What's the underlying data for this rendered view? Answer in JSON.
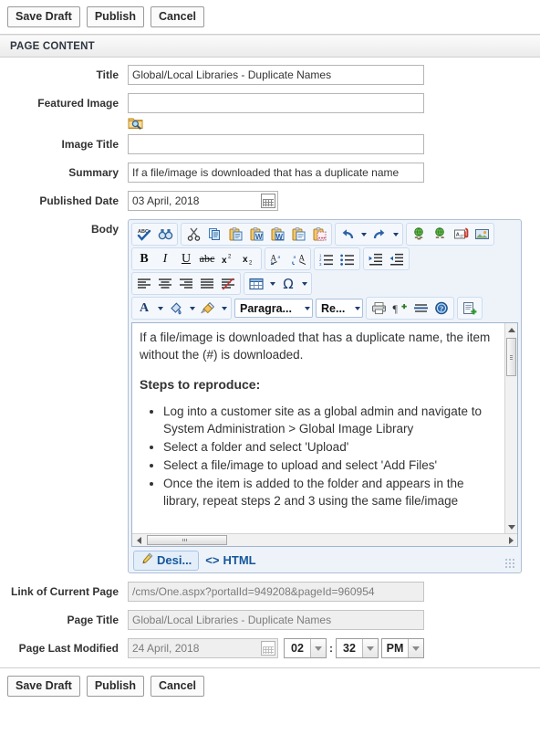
{
  "toolbar_top": {
    "save_draft": "Save Draft",
    "publish": "Publish",
    "cancel": "Cancel"
  },
  "toolbar_bottom": {
    "save_draft": "Save Draft",
    "publish": "Publish",
    "cancel": "Cancel"
  },
  "section": {
    "header": "PAGE CONTENT"
  },
  "fields": {
    "title": {
      "label": "Title",
      "value": "Global/Local Libraries - Duplicate Names",
      "placeholder": ""
    },
    "featured_image": {
      "label": "Featured Image",
      "value": "",
      "placeholder": "",
      "picker_icon": "folder-search-icon"
    },
    "image_title": {
      "label": "Image Title",
      "value": "",
      "placeholder": ""
    },
    "summary": {
      "label": "Summary",
      "value": "If a file/image is downloaded that has a duplicate name",
      "placeholder": ""
    },
    "published_date": {
      "label": "Published Date",
      "value": "03 April, 2018",
      "calendar_icon": "calendar-icon"
    },
    "body": {
      "label": "Body"
    },
    "link_of_current_page": {
      "label": "Link of Current Page",
      "value": "/cms/One.aspx?portalId=949208&pageId=960954"
    },
    "page_title": {
      "label": "Page Title",
      "value": "Global/Local Libraries - Duplicate Names"
    },
    "page_last_modified": {
      "label": "Page Last Modified",
      "date": "24 April, 2018",
      "hour": "02",
      "minute": "32",
      "meridiem": "PM",
      "separator": ":"
    }
  },
  "editor": {
    "toolbar_rows": [
      {
        "groups": [
          {
            "buttons": [
              {
                "name": "spell-check-icon",
                "glyph": "ABC"
              },
              {
                "name": "find-replace-icon",
                "glyph": "binoculars"
              }
            ]
          },
          {
            "buttons": [
              {
                "name": "cut-icon",
                "glyph": "scissors"
              },
              {
                "name": "copy-icon",
                "glyph": "copy"
              },
              {
                "name": "paste-icon",
                "glyph": "clipboard"
              },
              {
                "name": "paste-from-word-icon",
                "glyph": "clipboard-w"
              },
              {
                "name": "paste-from-word-strip-font-icon",
                "glyph": "clipboard-w2"
              },
              {
                "name": "paste-plain-text-icon",
                "glyph": "clipboard-text"
              },
              {
                "name": "paste-as-html-icon",
                "glyph": "clipboard-html"
              }
            ]
          },
          {
            "buttons": [
              {
                "name": "undo-icon",
                "glyph": "undo",
                "has_arrow": true
              },
              {
                "name": "redo-icon",
                "glyph": "redo",
                "has_arrow": true
              }
            ]
          },
          {
            "buttons": [
              {
                "name": "hyperlink-icon",
                "glyph": "globe-link"
              },
              {
                "name": "remove-hyperlink-icon",
                "glyph": "globe-unlink"
              },
              {
                "name": "insert-document-icon",
                "glyph": "doc-clip"
              },
              {
                "name": "insert-image-icon",
                "glyph": "image"
              }
            ]
          }
        ]
      },
      {
        "groups": [
          {
            "buttons": [
              {
                "name": "bold-icon",
                "glyph": "B"
              },
              {
                "name": "italic-icon",
                "glyph": "I"
              },
              {
                "name": "underline-icon",
                "glyph": "U"
              },
              {
                "name": "strikethrough-icon",
                "glyph": "abc"
              },
              {
                "name": "superscript-icon",
                "glyph": "x2-sup"
              },
              {
                "name": "subscript-icon",
                "glyph": "x2-sub"
              }
            ]
          },
          {
            "buttons": [
              {
                "name": "ltr-direction-icon",
                "glyph": "A-ltr"
              },
              {
                "name": "rtl-direction-icon",
                "glyph": "A-rtl"
              }
            ]
          },
          {
            "buttons": [
              {
                "name": "numbered-list-icon",
                "glyph": "ol"
              },
              {
                "name": "bulleted-list-icon",
                "glyph": "ul"
              }
            ]
          },
          {
            "buttons": [
              {
                "name": "indent-icon",
                "glyph": "indent"
              },
              {
                "name": "outdent-icon",
                "glyph": "outdent"
              }
            ]
          }
        ]
      },
      {
        "groups": [
          {
            "buttons": [
              {
                "name": "align-left-icon",
                "glyph": "al"
              },
              {
                "name": "align-center-icon",
                "glyph": "ac"
              },
              {
                "name": "align-right-icon",
                "glyph": "ar"
              },
              {
                "name": "align-justify-icon",
                "glyph": "aj"
              },
              {
                "name": "remove-alignment-icon",
                "glyph": "anone"
              }
            ]
          },
          {
            "buttons": [
              {
                "name": "insert-table-icon",
                "glyph": "table",
                "has_arrow": true
              },
              {
                "name": "insert-symbol-icon",
                "glyph": "omega",
                "has_arrow": true
              }
            ]
          }
        ]
      },
      {
        "groups": [
          {
            "buttons": [
              {
                "name": "foreground-color-icon",
                "glyph": "A-color",
                "has_arrow": true
              },
              {
                "name": "background-color-icon",
                "glyph": "paint-bucket",
                "has_arrow": true
              },
              {
                "name": "format-stripper-icon",
                "glyph": "brush",
                "has_arrow": true
              }
            ]
          },
          {
            "combos": [
              {
                "name": "paragraph-style-select",
                "value": "Paragra..."
              },
              {
                "name": "font-size-select",
                "value": "Re..."
              }
            ]
          },
          {
            "buttons": [
              {
                "name": "print-icon",
                "glyph": "printer"
              },
              {
                "name": "show-formatting-marks-icon",
                "glyph": "pilcrow-plus"
              },
              {
                "name": "insert-horizontal-rule-icon",
                "glyph": "hr"
              },
              {
                "name": "about-icon",
                "glyph": "help"
              }
            ]
          },
          {
            "buttons": [
              {
                "name": "insert-snippet-icon",
                "glyph": "snippet-plus"
              }
            ]
          }
        ]
      }
    ],
    "content": {
      "intro": "If a file/image is downloaded that has a duplicate name, the item without the (#) is downloaded.",
      "heading": "Steps to reproduce:",
      "steps": [
        "Log into a customer site as a global admin and navigate to System Administration > Global Image Library",
        "Select a folder and select 'Upload'",
        "Select a file/image to upload and select 'Add Files'",
        "Once the item is added to the folder and appears in the library, repeat steps 2 and 3 using the same file/image"
      ]
    },
    "tabs": [
      {
        "name": "tab-design",
        "label": "Desi...",
        "icon": "pencil-icon",
        "active": true
      },
      {
        "name": "tab-html",
        "label": "HTML",
        "icon": "angle-brackets-icon",
        "active": false
      }
    ]
  },
  "colors": {
    "accent_blue": "#15569b",
    "rte_border": "#b0bfd4",
    "rte_bg": "#eef3fa",
    "readonly_bg": "#efefef",
    "label_text": "#333333"
  }
}
